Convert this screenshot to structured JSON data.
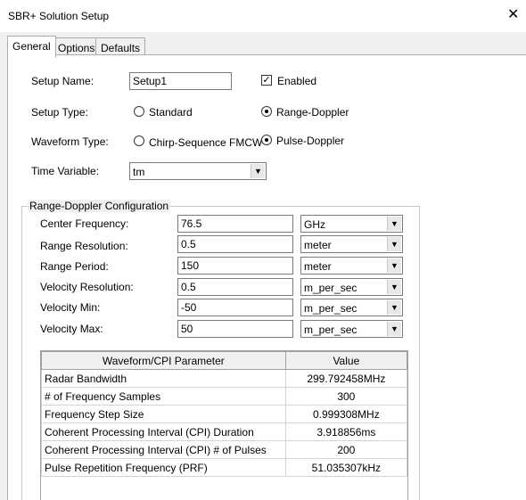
{
  "window": {
    "title": "SBR+ Solution Setup"
  },
  "tabs": [
    {
      "label": "General"
    },
    {
      "label": "Options"
    },
    {
      "label": "Defaults"
    }
  ],
  "general": {
    "setup_name_label": "Setup Name:",
    "setup_name_value": "Setup1",
    "enabled_label": "Enabled",
    "enabled_checked": true,
    "setup_type_label": "Setup Type:",
    "setup_type_options": [
      "Standard",
      "Range-Doppler"
    ],
    "setup_type_selected": "Range-Doppler",
    "waveform_type_label": "Waveform Type:",
    "waveform_type_options": [
      "Chirp-Sequence FMCW",
      "Pulse-Doppler"
    ],
    "waveform_type_selected": "Pulse-Doppler",
    "time_variable_label": "Time Variable:",
    "time_variable_value": "tm"
  },
  "range_doppler": {
    "group_label": "Range-Doppler Configuration",
    "fields": [
      {
        "label": "Center Frequency:",
        "value": "76.5",
        "unit": "GHz"
      },
      {
        "label": "Range Resolution:",
        "value": "0.5",
        "unit": "meter"
      },
      {
        "label": "Range Period:",
        "value": "150",
        "unit": "meter"
      },
      {
        "label": "Velocity Resolution:",
        "value": "0.5",
        "unit": "m_per_sec"
      },
      {
        "label": "Velocity Min:",
        "value": "-50",
        "unit": "m_per_sec"
      },
      {
        "label": "Velocity Max:",
        "value": "50",
        "unit": "m_per_sec"
      }
    ]
  },
  "param_table": {
    "headers": [
      "Waveform/CPI Parameter",
      "Value"
    ],
    "rows": [
      [
        "Radar Bandwidth",
        "299.792458MHz"
      ],
      [
        "# of Frequency Samples",
        "300"
      ],
      [
        "Frequency Step Size",
        "0.999308MHz"
      ],
      [
        "Coherent Processing Interval (CPI) Duration",
        "3.918856ms"
      ],
      [
        "Coherent Processing Interval (CPI) # of Pulses",
        "200"
      ],
      [
        "Pulse Repetition Frequency (PRF)",
        "51.035307kHz"
      ]
    ]
  },
  "icons": {
    "close": "close-icon",
    "check": "check-icon",
    "dropdown": "chevron-down-icon"
  }
}
